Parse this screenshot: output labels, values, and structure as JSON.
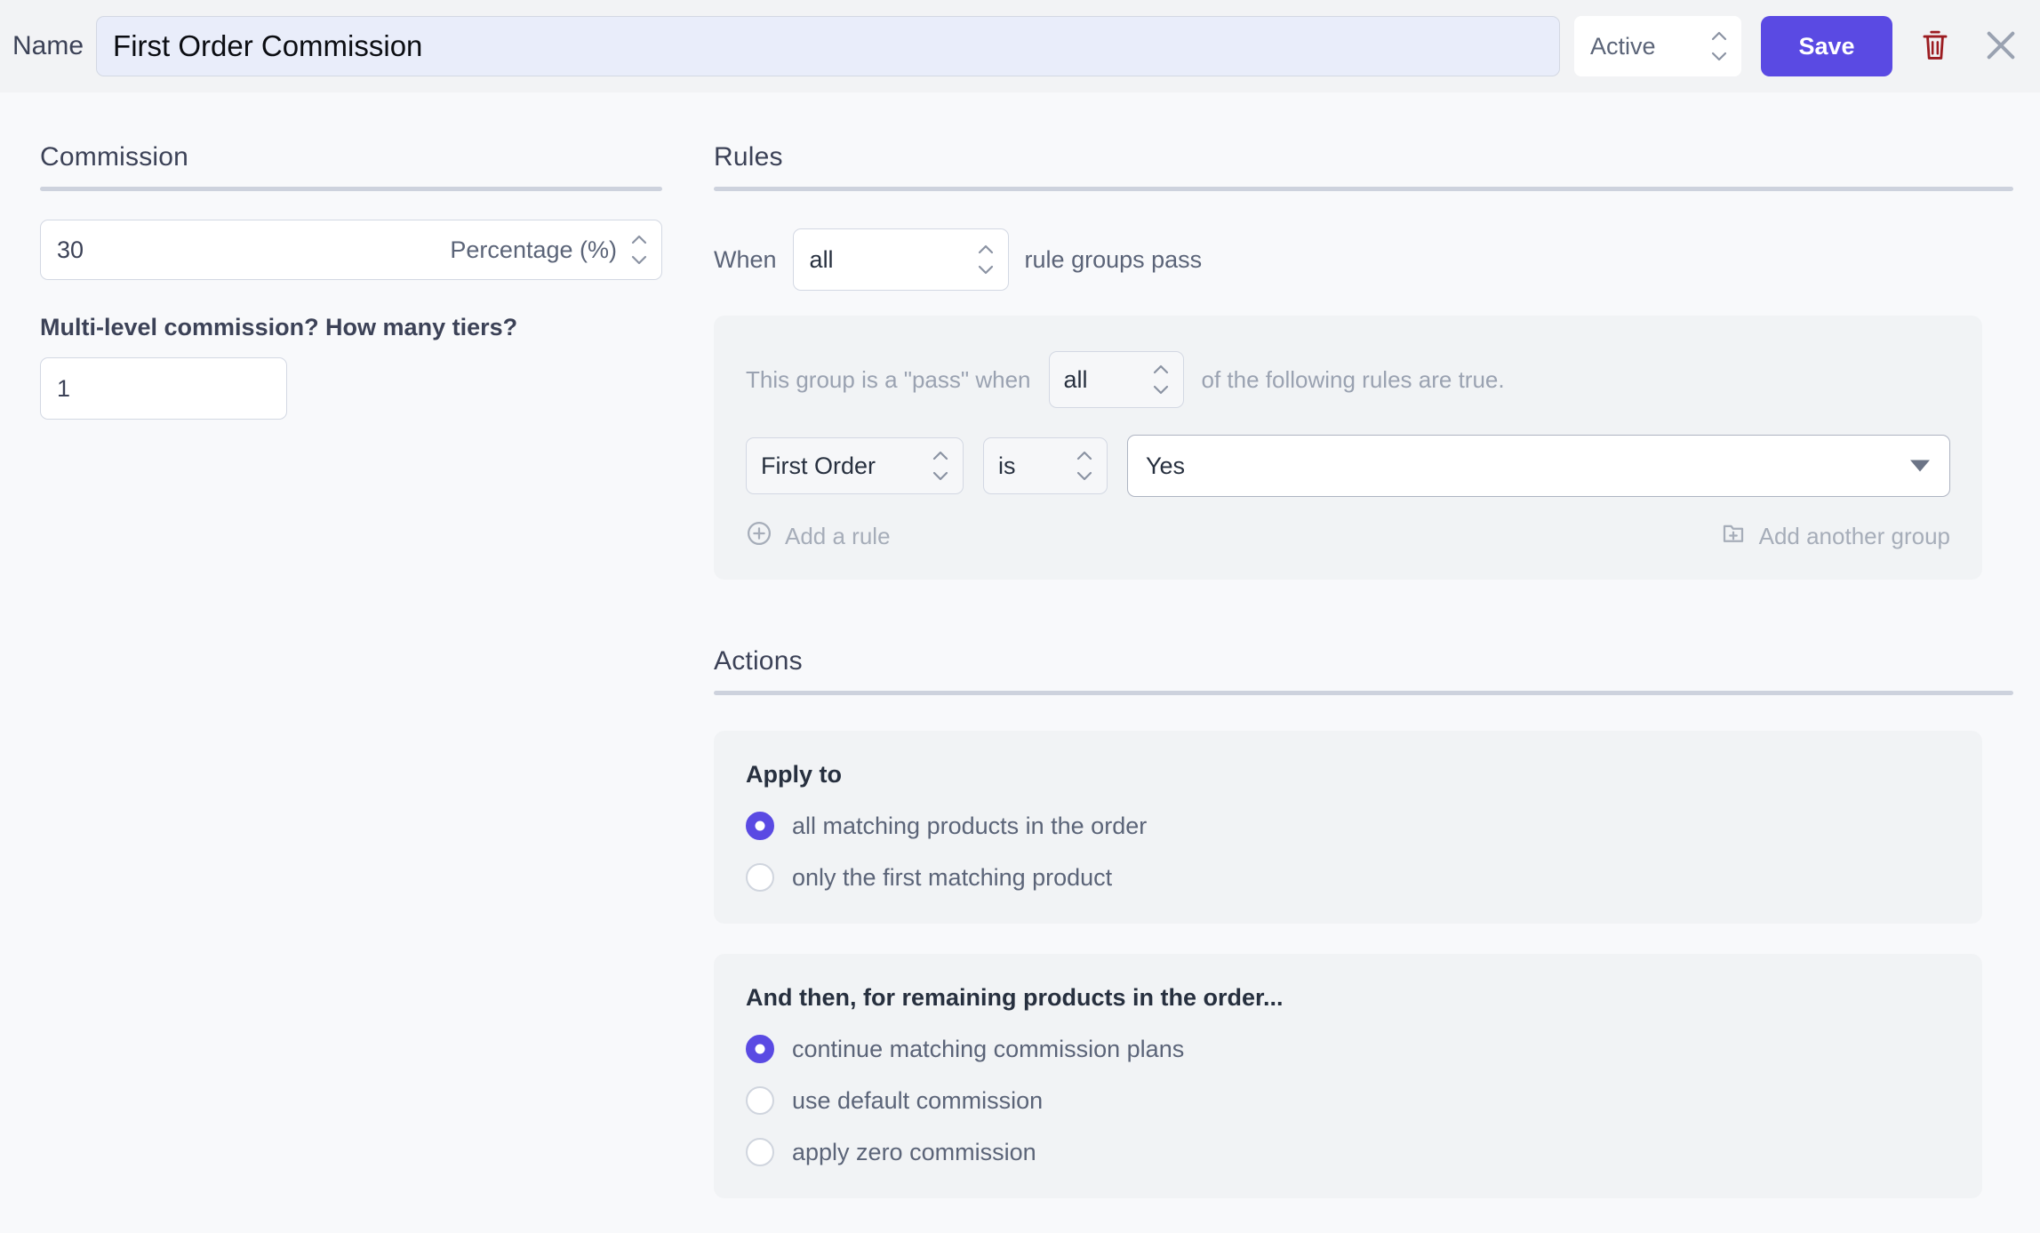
{
  "header": {
    "name_label": "Name",
    "name_value": "First Order Commission",
    "name_placeholder": "Name",
    "status_value": "Active",
    "save_label": "Save",
    "delete_icon": "trash-icon",
    "close_icon": "close-icon"
  },
  "commission": {
    "title": "Commission",
    "amount_value": "30",
    "amount_unit": "Percentage (%)",
    "tiers_label": "Multi-level commission? How many tiers?",
    "tiers_value": "1"
  },
  "rules": {
    "title": "Rules",
    "when_prefix": "When",
    "when_value": "all",
    "when_suffix": "rule groups pass",
    "group": {
      "prefix": "This group is a \"pass\" when",
      "match_value": "all",
      "suffix": "of the following rules are true.",
      "rows": [
        {
          "field": "First Order",
          "operator": "is",
          "value": "Yes"
        }
      ],
      "add_rule_label": "Add a rule",
      "add_group_label": "Add another group"
    }
  },
  "actions": {
    "title": "Actions",
    "apply_to": {
      "heading": "Apply to",
      "options": [
        {
          "label": "all matching products in the order",
          "selected": true
        },
        {
          "label": "only the first matching product",
          "selected": false
        }
      ]
    },
    "remaining": {
      "heading": "And then, for remaining products in the order...",
      "options": [
        {
          "label": "continue matching commission plans",
          "selected": true
        },
        {
          "label": "use default commission",
          "selected": false
        },
        {
          "label": "apply zero commission",
          "selected": false
        }
      ]
    }
  },
  "colors": {
    "accent": "#5a4ae3",
    "danger": "#9c1c21",
    "page_bg": "#f8f9fb",
    "header_bg": "#f2f3f5",
    "panel_bg": "#f1f3f5",
    "name_input_bg": "#e9edfa"
  }
}
